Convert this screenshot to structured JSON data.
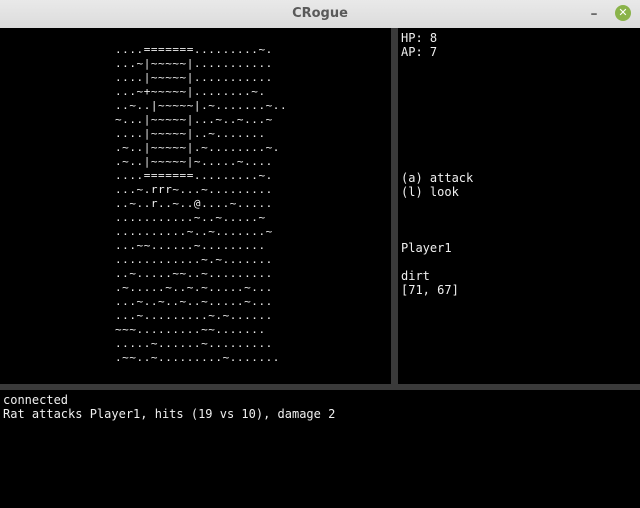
{
  "window": {
    "title": "CRogue",
    "minimize_glyph": "–",
    "close_glyph": "✕"
  },
  "map": {
    "lines": [
      "....=======.........~.",
      "...~|~~~~~|...........",
      "....|~~~~~|...........",
      "...~+~~~~~|........~.",
      "..~..|~~~~~|.~.......~..",
      "~...|~~~~~|...~..~...~",
      "....|~~~~~|..~.......",
      ".~..|~~~~~|.~........~.",
      ".~..|~~~~~|~.....~....",
      "....=======.........~.",
      "...~.rrr~...~.........",
      "..~..r..~..@....~.....",
      "...........~..~.....~",
      "..........~..~.......~",
      "...~~......~.........",
      "............~.~.......",
      "..~.....~~..~.........",
      ".~.....~..~.~.....~...",
      "...~..~..~..~.....~...",
      "...~.........~.~......",
      "~~~.........~~.......",
      ".....~......~.........",
      ".~~..~.........~......."
    ]
  },
  "status": {
    "hp": "HP: 8",
    "ap": "AP: 7"
  },
  "actions": [
    "(a) attack",
    "(l) look"
  ],
  "info": {
    "player": "Player1",
    "terrain": "dirt",
    "coords": "[71, 67]"
  },
  "log": [
    "connected",
    "Rat attacks Player1, hits (19 vs 10), damage 2"
  ]
}
